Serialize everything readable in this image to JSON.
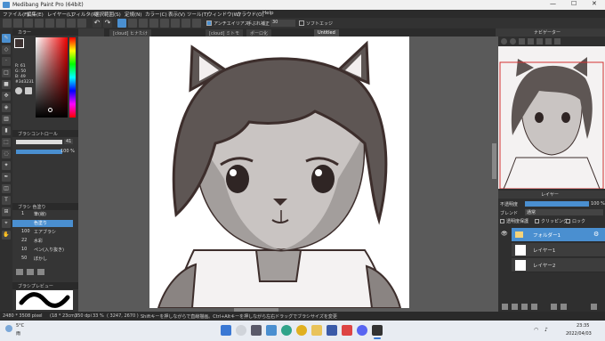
{
  "window": {
    "title": "Medibang Paint Pro (64bit)"
  },
  "menu": [
    "ファイル(F)",
    "編集(E)",
    "レイヤー(L)",
    "フィルタ(R)",
    "選択範囲(S)",
    "定規(N)",
    "カラー(C)",
    "表示(V)",
    "ツール(T)",
    "ウィンドウ(W)",
    "クラウド(O)",
    "Help"
  ],
  "toolbar": {
    "antialias": "アンチエイリアス",
    "correction_label": "手ぶれ補正",
    "correction_value": "30",
    "softedge": "ソフトエッジ"
  },
  "tabs": [
    "[cloud] ヒナたけ",
    "[cloud] ミトモ",
    "ポーロ化",
    "Untitled"
  ],
  "color_panel": {
    "title": "カラー",
    "r": "R: 61",
    "g": "G: 50",
    "b": "B: 49",
    "hex": "#3d3231"
  },
  "brush_control": {
    "title": "ブラシコントロール",
    "size": "41",
    "opacity": "100 %"
  },
  "brush_list": {
    "title": "ブラシ 色塗り",
    "items": [
      {
        "size": "1",
        "name": "筆(線)"
      },
      {
        "size": "",
        "name": "色塗り"
      },
      {
        "size": "100",
        "name": "エアブラシ"
      },
      {
        "size": "22",
        "name": "水彩"
      },
      {
        "size": "10",
        "name": "ペン(入り抜き)"
      },
      {
        "size": "50",
        "name": "ぼかし"
      }
    ]
  },
  "brush_preview": {
    "title": "ブラシプレビュー"
  },
  "navigator": {
    "title": "ナビゲーター"
  },
  "layer_panel": {
    "title": "レイヤー",
    "opacity_label": "不透明度",
    "opacity_value": "100 %",
    "blend_label": "ブレンド",
    "blend_value": "通常",
    "protect": "透明度保護",
    "clipping": "クリッピング",
    "lock": "ロック",
    "layers": [
      {
        "name": "フォルダー1",
        "selected": true
      },
      {
        "name": "レイヤー1",
        "selected": false
      },
      {
        "name": "レイヤー2",
        "selected": false
      }
    ]
  },
  "status": {
    "size": "2480 * 3508 pixel",
    "mm": "(18 * 23cm)",
    "dpi": "350 dpi",
    "zoom": "33 %",
    "coords": "( 3247, 2670 )",
    "hint": "Shiftキーを押しながらで直線描画。Ctrl+Altキーを押しながら左右ドラッグでブラシサイズを変更"
  },
  "taskbar": {
    "temp": "5°C",
    "weather": "雨",
    "time": "23:35",
    "date": "2022/04/03"
  },
  "colors": {
    "skin": "#a39e9c",
    "hair": "#5e5654",
    "line": "#3d2e2c",
    "accent": "#4a8fd0"
  }
}
